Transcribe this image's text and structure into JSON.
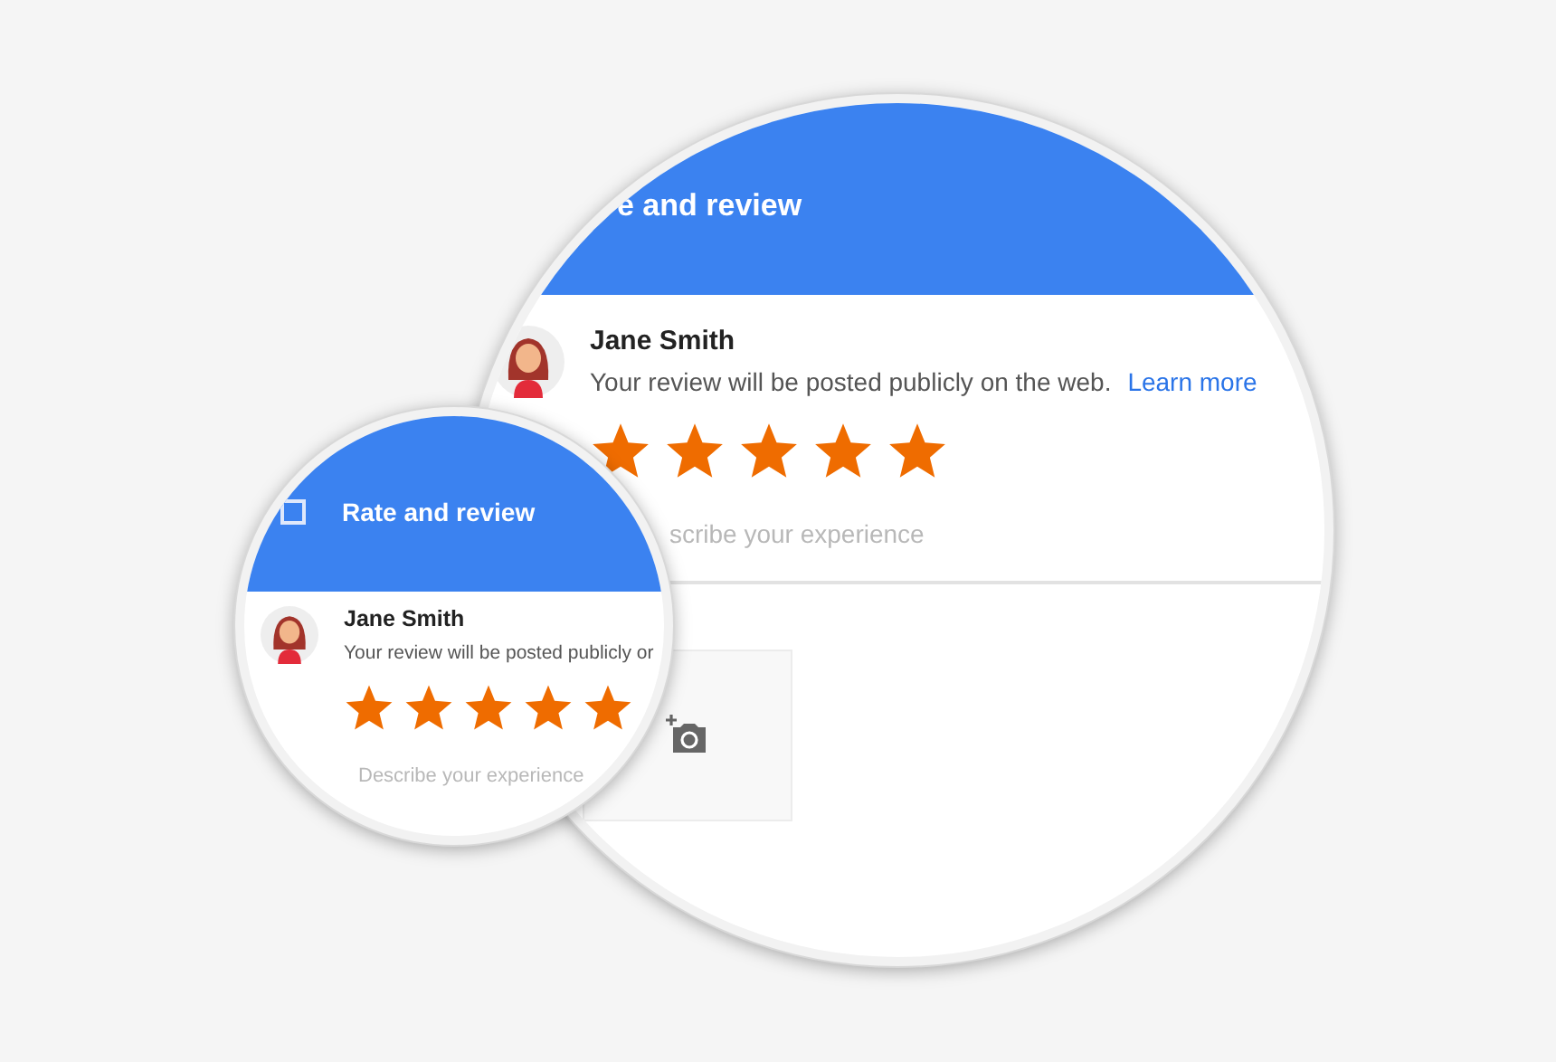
{
  "magnifiers": [
    {
      "kind": "large",
      "title": "e and review",
      "user": {
        "name": "Jane Smith",
        "notice": "Your review will be posted publicly on the web.",
        "link": "Learn more"
      },
      "stars": 5,
      "review": {
        "placeholder": "scribe your experience"
      },
      "photo_upload": true
    },
    {
      "kind": "small",
      "title": "Rate and review",
      "user": {
        "name": "Jane Smith",
        "notice": "Your review will be posted publicly or"
      },
      "stars": 5,
      "review": {
        "placeholder": "Describe your experience"
      },
      "photo_upload": false
    }
  ]
}
